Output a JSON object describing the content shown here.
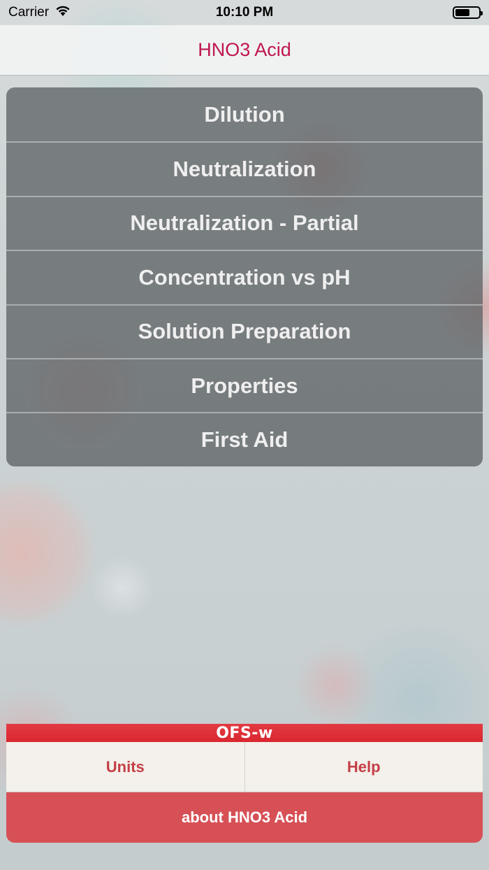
{
  "status_bar": {
    "carrier": "Carrier",
    "time": "10:10 PM",
    "wifi_icon": "wifi-icon",
    "battery_icon": "battery-icon"
  },
  "nav": {
    "title": "HNO3 Acid",
    "title_color": "#c0174e"
  },
  "menu": {
    "items": [
      {
        "label": "Dilution"
      },
      {
        "label": "Neutralization"
      },
      {
        "label": "Neutralization - Partial"
      },
      {
        "label": "Concentration vs pH"
      },
      {
        "label": "Solution Preparation"
      },
      {
        "label": "Properties"
      },
      {
        "label": "First Aid"
      }
    ]
  },
  "bottom": {
    "brand": "OFS-w",
    "units_label": "Units",
    "help_label": "Help",
    "about_label": "about HNO3 Acid",
    "accent_color": "#d65056"
  }
}
